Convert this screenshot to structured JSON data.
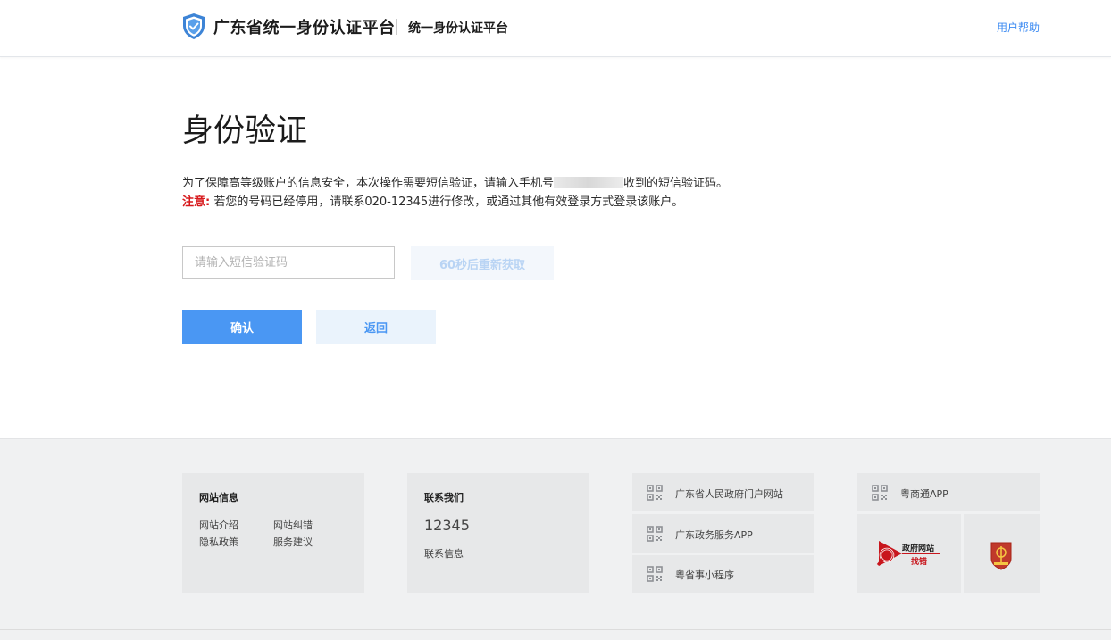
{
  "header": {
    "brand_title": "广东省统一身份认证平台",
    "brand_sub": "统一身份认证平台",
    "help_link": "用户帮助"
  },
  "main": {
    "title": "身份验证",
    "desc_before": "为了保障高等级账户的信息安全，本次操作需要短信验证，请输入手机号",
    "desc_after": "收到的短信验证码。",
    "note_label": "注意:",
    "note_text": " 若您的号码已经停用，请联系020-12345进行修改，或通过其他有效登录方式登录该账户。",
    "code_placeholder": "请输入短信验证码",
    "resend_label": "60秒后重新获取",
    "confirm_label": "确认",
    "back_label": "返回"
  },
  "footer": {
    "site_info": {
      "title": "网站信息",
      "links": [
        "网站介绍",
        "网站纠错",
        "隐私政策",
        "服务建议"
      ]
    },
    "contact": {
      "title": "联系我们",
      "phone": "12345",
      "info_link": "联系信息"
    },
    "portals": [
      "广东省人民政府门户网站",
      "广东政务服务APP",
      "粤省事小程序"
    ],
    "app": "粤商通APP",
    "badge_text": [
      "政府网站",
      "找错"
    ]
  },
  "colors": {
    "accent": "#4a97f3",
    "warning": "#d7191c"
  }
}
